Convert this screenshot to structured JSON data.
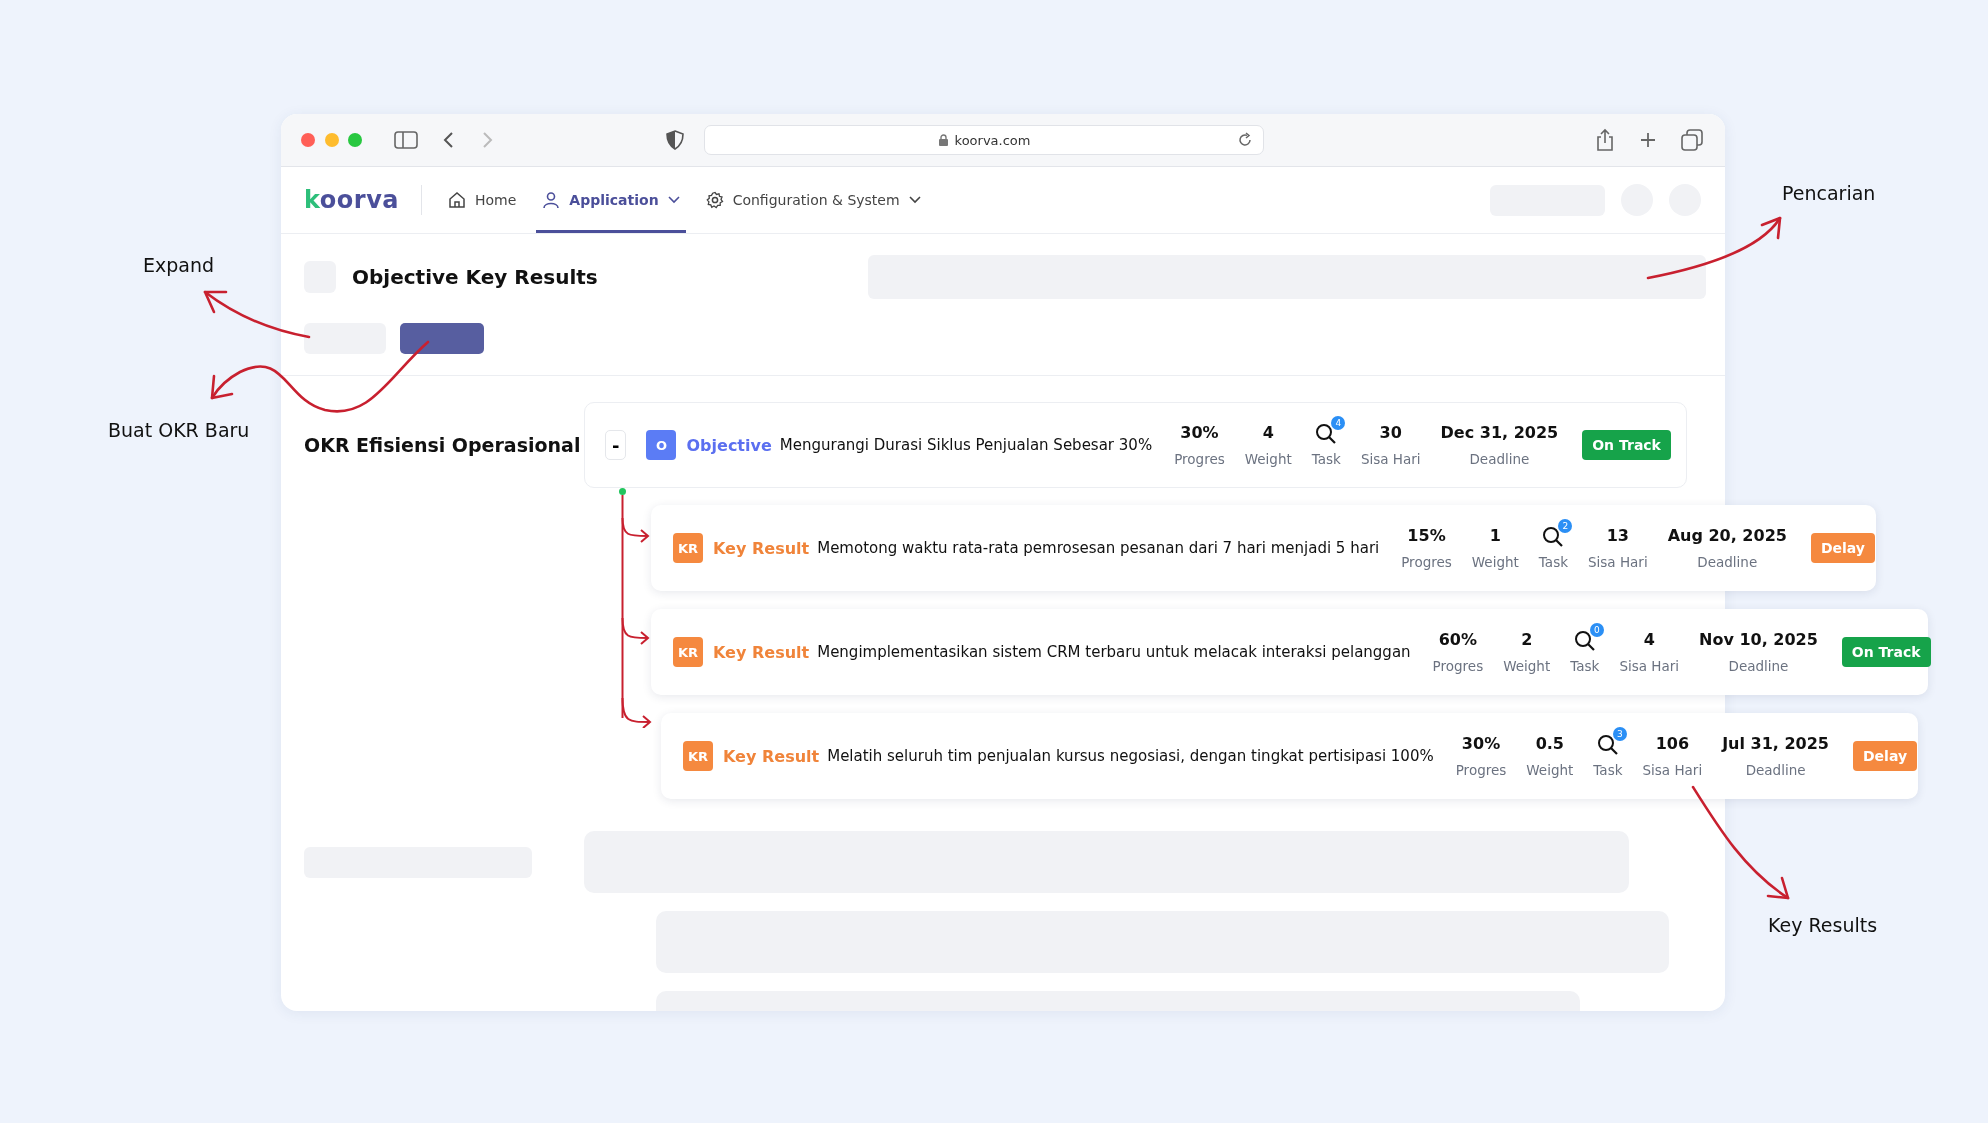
{
  "browser": {
    "url": "koorva.com"
  },
  "nav": {
    "logo": "koorva",
    "items": [
      {
        "kind": "home",
        "label": "Home",
        "selected": false,
        "dropdown": false
      },
      {
        "kind": "user",
        "label": "Application",
        "selected": true,
        "dropdown": true
      },
      {
        "kind": "gear",
        "label": "Configuration & System",
        "selected": false,
        "dropdown": true
      }
    ]
  },
  "page_title": "Objective Key Results",
  "okr": {
    "title": "OKR Efisiensi Operasional",
    "toggle": "-",
    "objective": {
      "badge": "O",
      "type_label": "Objective",
      "text": "Mengurangi Durasi Siklus Penjualan Sebesar 30%",
      "stats": [
        {
          "kind": "value",
          "value": "30%",
          "label": "Progres"
        },
        {
          "kind": "value",
          "value": "4",
          "label": "Weight"
        },
        {
          "kind": "task",
          "count": "4",
          "label": "Task"
        },
        {
          "kind": "value",
          "value": "30",
          "label": "Sisa Hari"
        },
        {
          "kind": "value",
          "value": "Dec 31, 2025",
          "label": "Deadline"
        }
      ],
      "status": {
        "kind": "on-track",
        "label": "On Track"
      }
    },
    "key_results": [
      {
        "badge": "KR",
        "type_label": "Key Result",
        "text": "Memotong waktu rata-rata pemrosesan pesanan dari 7 hari menjadi 5 hari",
        "stats": [
          {
            "kind": "value",
            "value": "15%",
            "label": "Progres"
          },
          {
            "kind": "value",
            "value": "1",
            "label": "Weight"
          },
          {
            "kind": "task",
            "count": "2",
            "label": "Task"
          },
          {
            "kind": "value",
            "value": "13",
            "label": "Sisa Hari"
          },
          {
            "kind": "value",
            "value": "Aug 20, 2025",
            "label": "Deadline"
          }
        ],
        "status": {
          "kind": "delay",
          "label": "Delay"
        }
      },
      {
        "badge": "KR",
        "type_label": "Key Result",
        "text": "Mengimplementasikan sistem CRM terbaru untuk melacak interaksi pelanggan",
        "stats": [
          {
            "kind": "value",
            "value": "60%",
            "label": "Progres"
          },
          {
            "kind": "value",
            "value": "2",
            "label": "Weight"
          },
          {
            "kind": "task",
            "count": "0",
            "label": "Task"
          },
          {
            "kind": "value",
            "value": "4",
            "label": "Sisa Hari"
          },
          {
            "kind": "value",
            "value": "Nov 10, 2025",
            "label": "Deadline"
          }
        ],
        "status": {
          "kind": "on-track",
          "label": "On Track"
        }
      },
      {
        "badge": "KR",
        "type_label": "Key Result",
        "text": "Melatih seluruh tim penjualan kursus negosiasi, dengan tingkat pertisipasi 100%",
        "stats": [
          {
            "kind": "value",
            "value": "30%",
            "label": "Progres"
          },
          {
            "kind": "value",
            "value": "0.5",
            "label": "Weight"
          },
          {
            "kind": "task",
            "count": "3",
            "label": "Task"
          },
          {
            "kind": "value",
            "value": "106",
            "label": "Sisa Hari"
          },
          {
            "kind": "value",
            "value": "Jul 31, 2025",
            "label": "Deadline"
          }
        ],
        "status": {
          "kind": "delay",
          "label": "Delay"
        }
      }
    ]
  },
  "annotations": [
    {
      "label": "Expand"
    },
    {
      "label": "Pencarian"
    },
    {
      "label": "Buat OKR Baru"
    },
    {
      "label": "Key Results"
    }
  ]
}
